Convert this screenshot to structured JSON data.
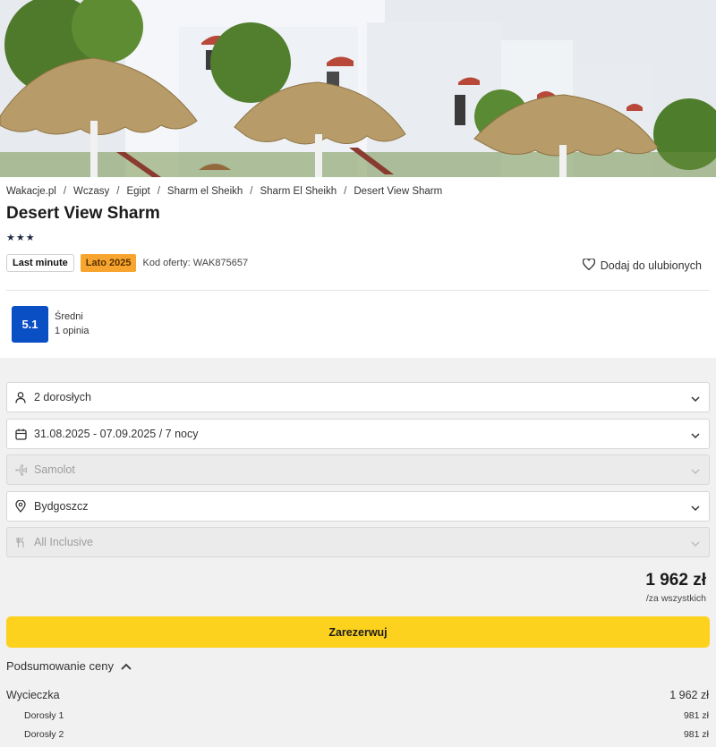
{
  "breadcrumb": [
    "Wakacje.pl",
    "Wczasy",
    "Egipt",
    "Sharm el Sheikh",
    "Sharm El Sheikh",
    "Desert View Sharm"
  ],
  "hotel": {
    "name": "Desert View Sharm",
    "stars": "★★★",
    "star_rating": 3
  },
  "tags": {
    "last_minute": "Last minute",
    "season": "Lato 2025",
    "offer_code": "Kod oferty: WAK875657"
  },
  "favorite": {
    "label": "Dodaj do ulubionych",
    "icon": "heart-icon"
  },
  "rating": {
    "score": "5.1",
    "label": "Średni",
    "reviews": "1 opinia",
    "color": "#0b4fc5"
  },
  "filters": {
    "travelers": {
      "value": "2 dorosłych",
      "icon": "person-icon"
    },
    "dates": {
      "value": "31.08.2025 - 07.09.2025 / 7 nocy",
      "icon": "calendar-icon"
    },
    "transport": {
      "value": "Samolot",
      "icon": "plane-icon",
      "disabled": true
    },
    "departure": {
      "value": "Bydgoszcz",
      "icon": "location-pin-icon"
    },
    "board": {
      "value": "All Inclusive",
      "icon": "cutlery-icon",
      "disabled": true
    }
  },
  "price": {
    "amount": "1 962 zł",
    "note": "/za wszystkich"
  },
  "book_button": {
    "label": "Zarezerwuj",
    "color": "#fdd21f"
  },
  "summary": {
    "toggle_label": "Podsumowanie ceny",
    "rows": [
      {
        "label": "Wycieczka",
        "value": "1 962 zł"
      },
      {
        "label": "Dorosły 1",
        "value": "981 zł"
      },
      {
        "label": "Dorosły 2",
        "value": "981 zł"
      }
    ]
  }
}
